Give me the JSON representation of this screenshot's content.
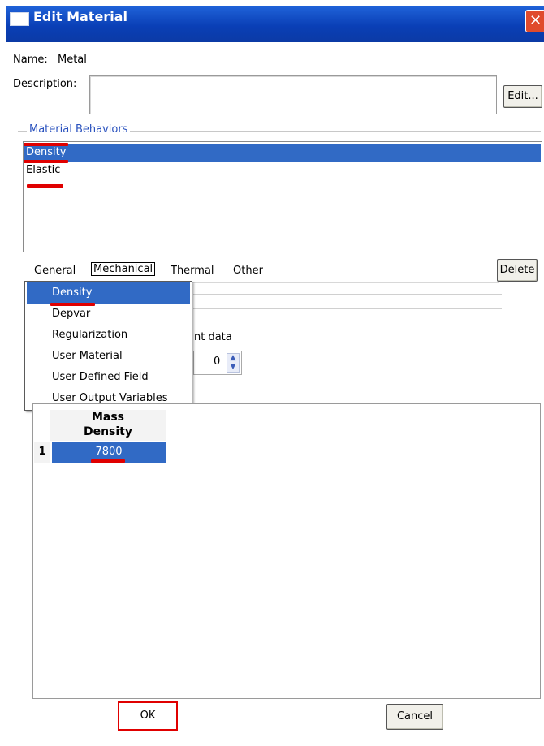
{
  "window": {
    "title": "Edit Material",
    "close_glyph": "✕"
  },
  "name": {
    "label": "Name:",
    "value": "Metal"
  },
  "description": {
    "label": "Description:",
    "value": "",
    "edit_button": "Edit..."
  },
  "behaviors": {
    "group_label": "Material Behaviors",
    "items": [
      {
        "label": "Density",
        "selected": true
      },
      {
        "label": "Elastic",
        "selected": false
      }
    ]
  },
  "menubar": {
    "items": [
      "General",
      "Mechanical",
      "Thermal",
      "Other"
    ],
    "delete_button": "Delete"
  },
  "general_menu": {
    "items": [
      "Density",
      "Depvar",
      "Regularization",
      "User Material",
      "User Defined Field",
      "User Output Variables"
    ],
    "selected": "Density"
  },
  "partial_label": "nt data",
  "spinner_value": "0",
  "table": {
    "header_line1": "Mass",
    "header_line2": "Density",
    "rows": [
      {
        "index": "1",
        "value": "7800"
      }
    ]
  },
  "buttons": {
    "ok": "OK",
    "cancel": "Cancel"
  },
  "colors": {
    "titlebar": "#0a3fb6",
    "selection": "#316ac5",
    "highlight": "#e00000"
  },
  "icons": {
    "title": "window-icon",
    "close": "close-icon",
    "spinner": "spinner-arrows-icon"
  }
}
